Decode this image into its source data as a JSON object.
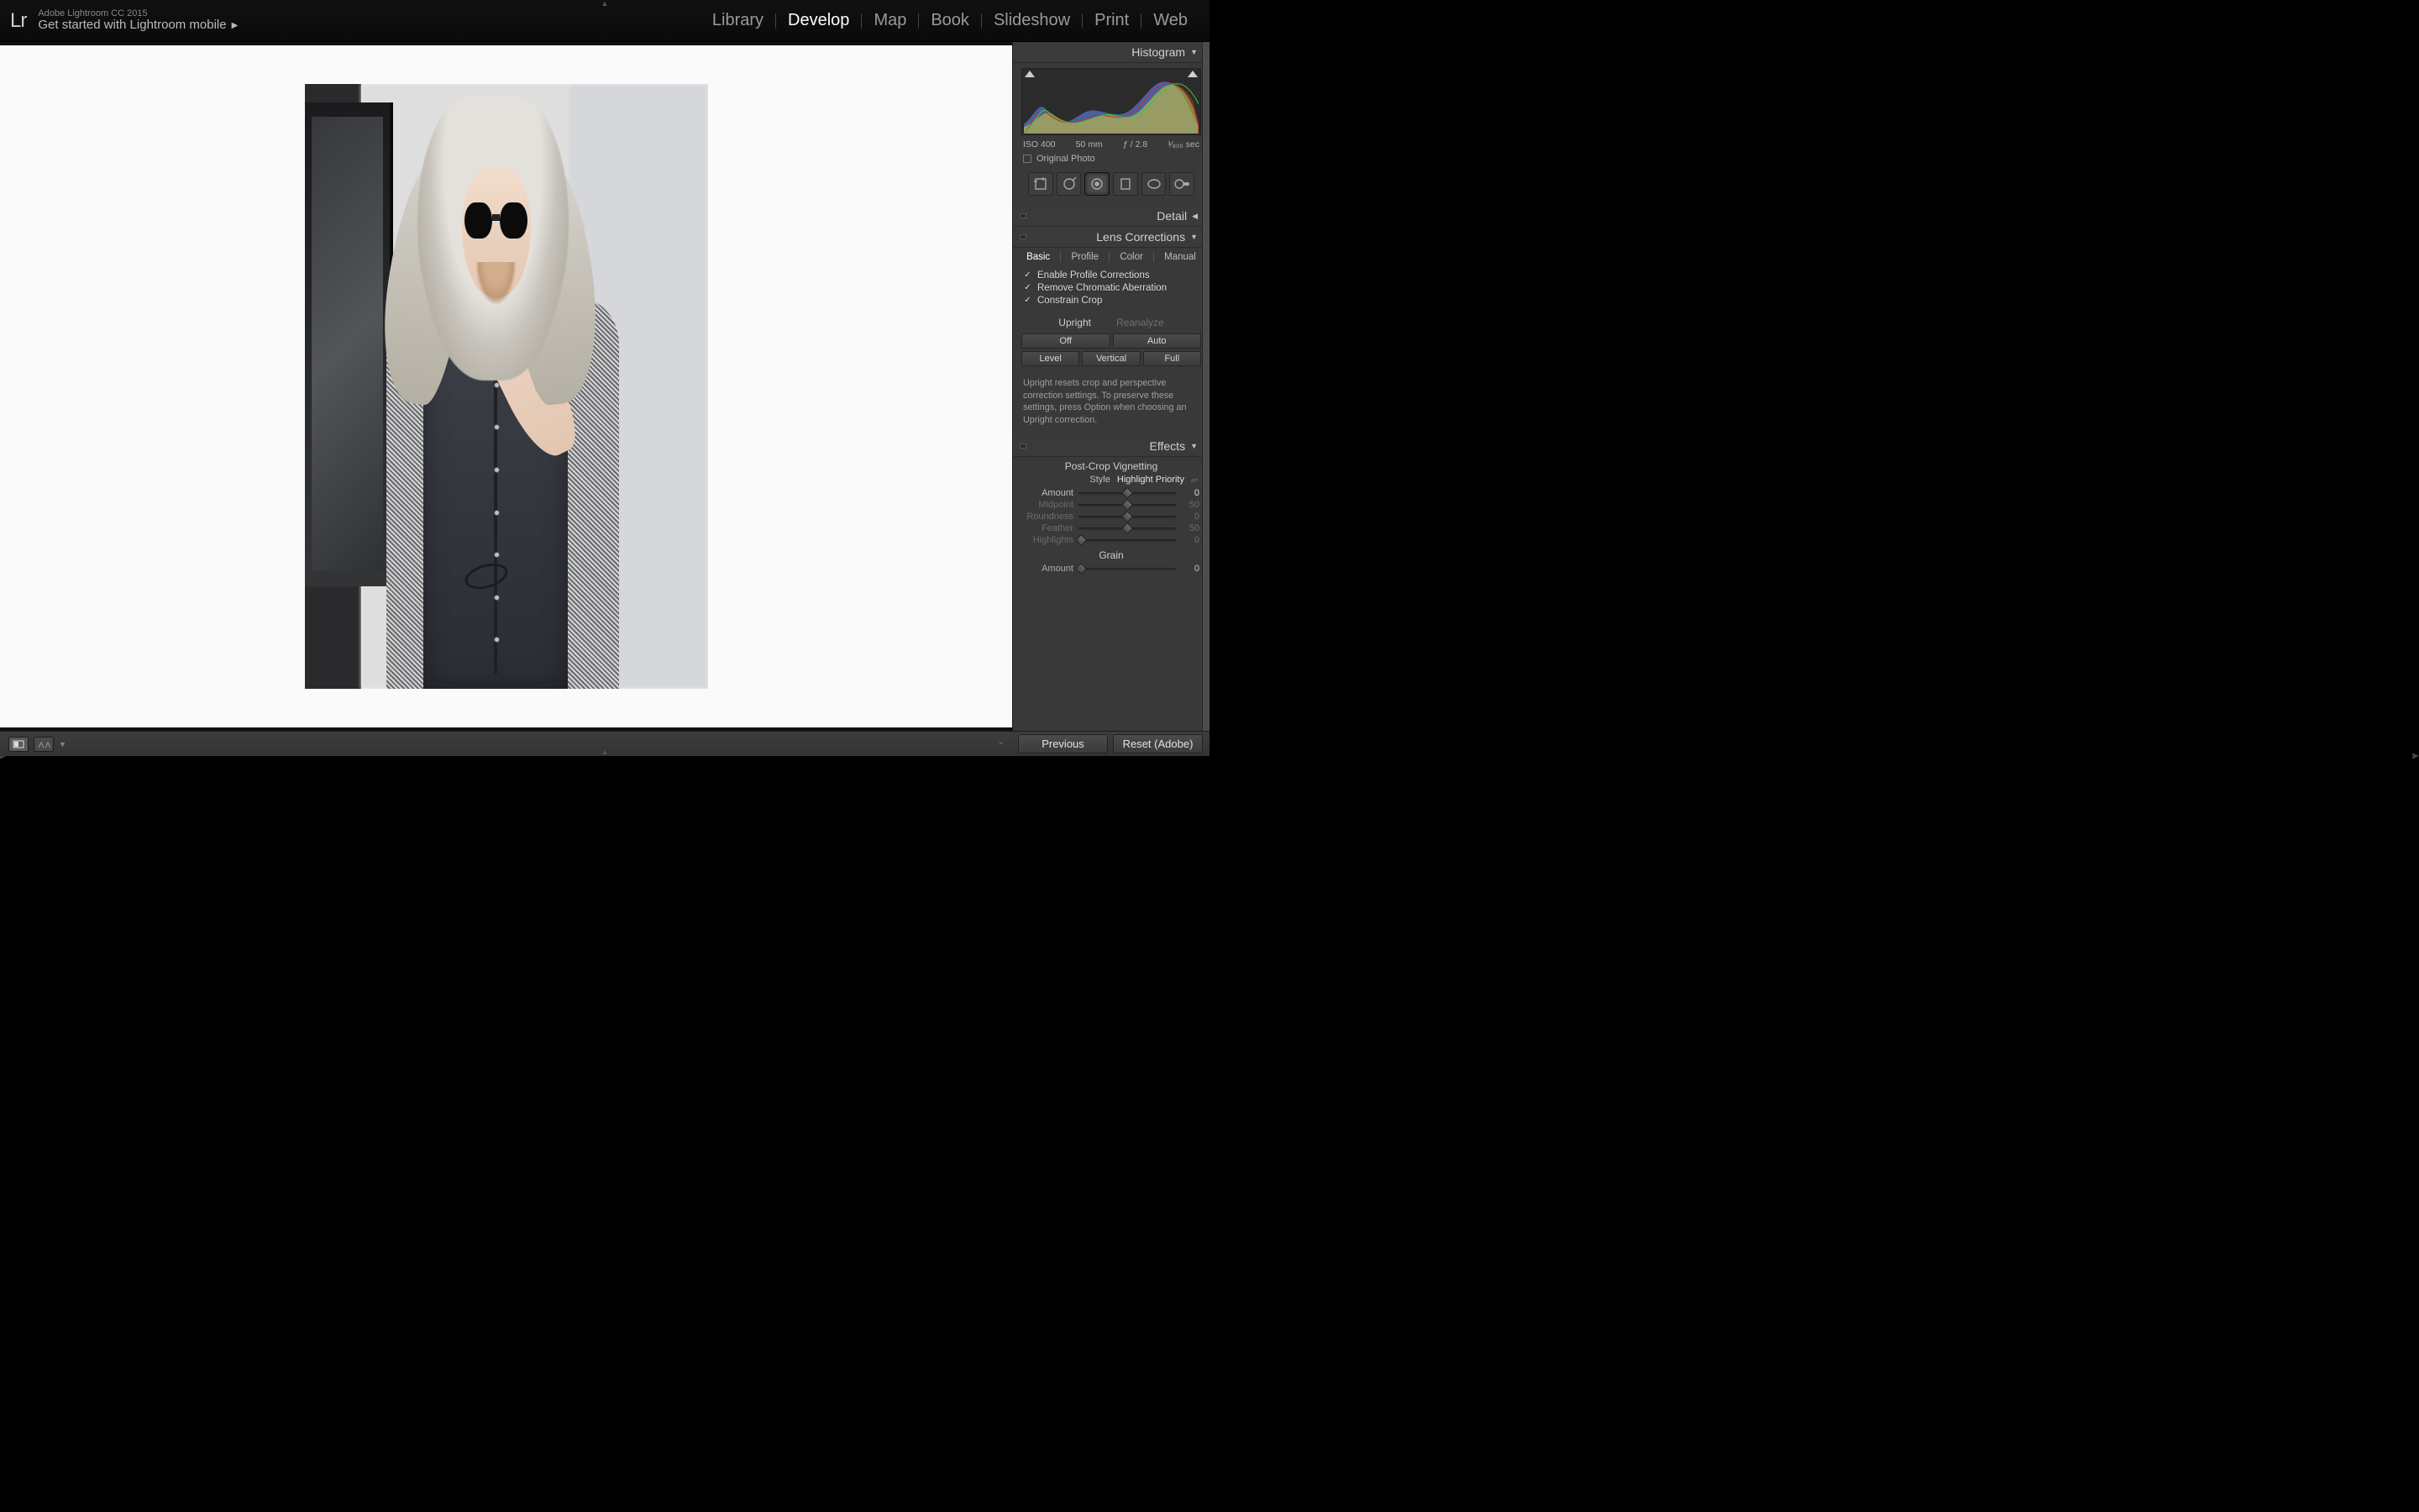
{
  "app": {
    "logo": "Lr",
    "title": "Adobe Lightroom CC 2015",
    "get_started": "Get started with Lightroom mobile"
  },
  "modules": {
    "items": [
      "Library",
      "Develop",
      "Map",
      "Book",
      "Slideshow",
      "Print",
      "Web"
    ],
    "active": "Develop"
  },
  "histogram": {
    "title": "Histogram",
    "meta": {
      "iso": "ISO 400",
      "focal": "50 mm",
      "aperture": "ƒ / 2.8",
      "shutter": "¹⁄₈₀₀ sec"
    },
    "original_label": "Original Photo"
  },
  "tools": {
    "names": [
      "crop-tool",
      "spot-removal-tool",
      "red-eye-tool",
      "graduated-filter-tool",
      "radial-filter-tool",
      "adjustment-brush-tool"
    ],
    "active_index": 2
  },
  "panels": {
    "detail_title": "Detail",
    "lens": {
      "title": "Lens Corrections",
      "tabs": [
        "Basic",
        "Profile",
        "Color",
        "Manual"
      ],
      "active_tab": "Basic",
      "checks": {
        "enable_profile": "Enable Profile Corrections",
        "remove_ca": "Remove Chromatic Aberration",
        "constrain": "Constrain Crop"
      },
      "upright_label": "Upright",
      "reanalyze_label": "Reanalyze",
      "buttons": {
        "off": "Off",
        "auto": "Auto",
        "level": "Level",
        "vertical": "Vertical",
        "full": "Full"
      },
      "note": "Upright resets crop and perspective correction settings. To preserve these settings, press Option when choosing an Upright correction."
    },
    "effects": {
      "title": "Effects",
      "vignette_title": "Post-Crop Vignetting",
      "style_label": "Style",
      "style_value": "Highlight Priority",
      "sliders": [
        {
          "label": "Amount",
          "value": 0,
          "pos": 50,
          "enabled": true
        },
        {
          "label": "Midpoint",
          "value": 50,
          "pos": 50,
          "enabled": false
        },
        {
          "label": "Roundness",
          "value": 0,
          "pos": 50,
          "enabled": false
        },
        {
          "label": "Feather",
          "value": 50,
          "pos": 50,
          "enabled": false
        },
        {
          "label": "Highlights",
          "value": 0,
          "pos": 3,
          "enabled": false
        }
      ],
      "grain_title": "Grain",
      "grain_amount_label": "Amount",
      "grain_amount_value": 0
    }
  },
  "footer": {
    "previous": "Previous",
    "reset": "Reset (Adobe)"
  }
}
